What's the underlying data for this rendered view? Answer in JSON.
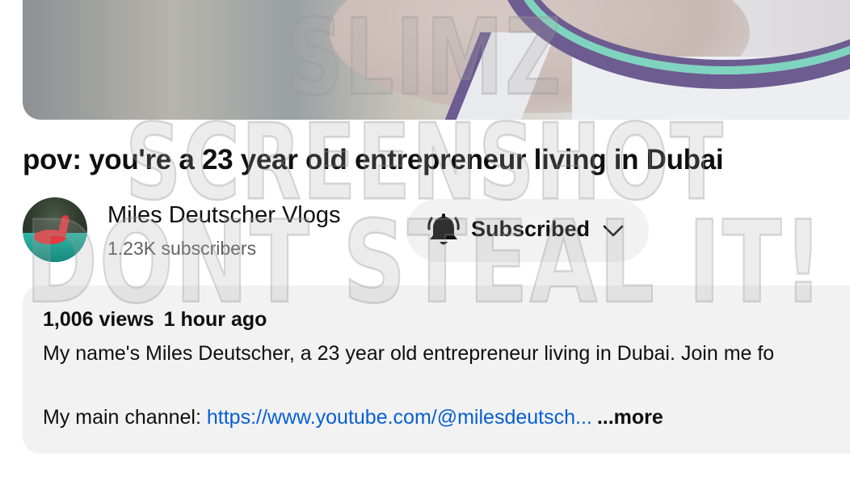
{
  "video": {
    "title": "pov: you're a 23 year old entrepreneur living in Dubai"
  },
  "watermark": {
    "line1": "SLIMZ SCREENSHOT",
    "line2": "DONT STEAL IT!"
  },
  "channel": {
    "name": "Miles Deutscher Vlogs",
    "subscribers": "1.23K subscribers",
    "avatar_icon": "avatar-pink-flamingo-float"
  },
  "subscribe": {
    "label": "Subscribed",
    "bell_icon": "bell-icon",
    "chevron_icon": "chevron-down-icon"
  },
  "description": {
    "views": "1,006 views",
    "time": "1 hour ago",
    "text_line1": "My name's Miles Deutscher, a 23 year old entrepreneur living in Dubai. Join me fo",
    "channel_label": "My main channel: ",
    "link_text": "https://www.youtube.com/@milesdeutsch...",
    "more_label": "...more"
  },
  "colors": {
    "link": "#065fd4",
    "panel_bg": "#f2f2f2",
    "text": "#0f0f0f",
    "secondary_text": "#606060"
  }
}
